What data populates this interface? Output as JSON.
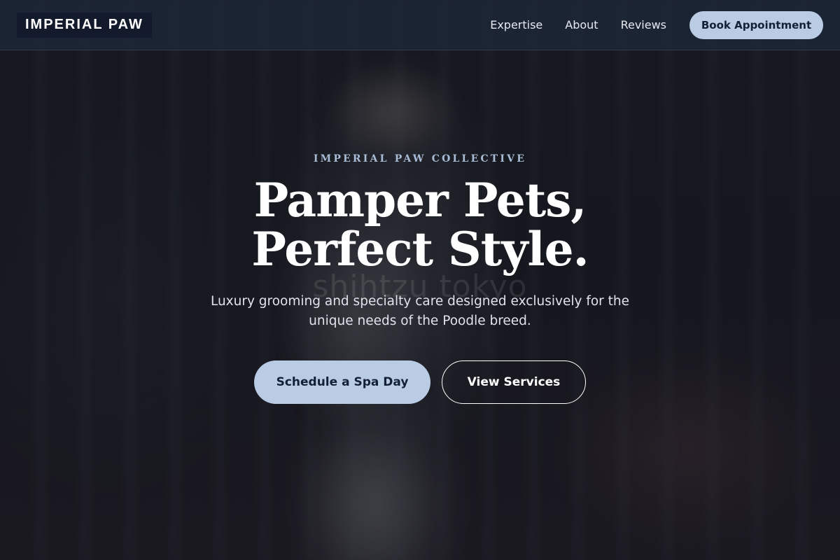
{
  "brand": {
    "logo_text": "IMPERIAL PAW"
  },
  "nav": {
    "links": [
      {
        "label": "Expertise"
      },
      {
        "label": "About"
      },
      {
        "label": "Reviews"
      }
    ],
    "cta_label": "Book Appointment"
  },
  "hero": {
    "eyebrow": "IMPERIAL PAW COLLECTIVE",
    "headline_line1": "Pamper Pets,",
    "headline_line2": "Perfect Style.",
    "subtext": "Luxury grooming and specialty care designed exclusively for the unique needs of the Poodle breed.",
    "primary_cta": "Schedule a Spa Day",
    "secondary_cta": "View Services",
    "photo_watermark": "shihtzu tokyo"
  },
  "colors": {
    "accent": "#b9cce3",
    "navbar": "#1e2838",
    "logo_bg": "#121a2b",
    "button_text": "#132036",
    "eyebrow": "#a9bcd6"
  }
}
